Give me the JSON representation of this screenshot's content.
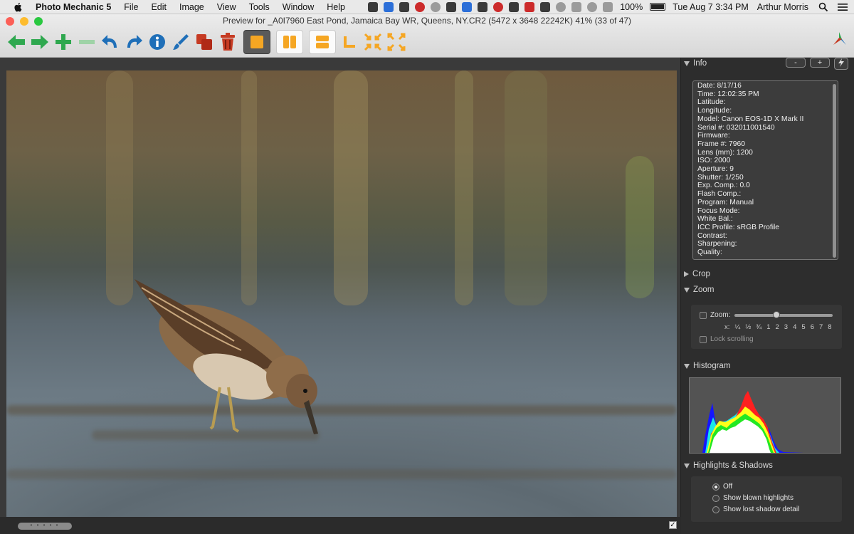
{
  "menubar": {
    "items": [
      "Photo Mechanic 5",
      "File",
      "Edit",
      "Image",
      "View",
      "Tools",
      "Window",
      "Help"
    ],
    "status": {
      "battery": "100%",
      "datetime": "Tue Aug 7  3:34 PM",
      "user": "Arthur Morris"
    }
  },
  "window": {
    "title": "Preview for _A0I7960 East Pond, Jamaica Bay WR, Queens, NY.CR2 (5472 x 3648 22242K) 41% (33 of 47)"
  },
  "toolbar": {
    "icons": [
      "prev-arrow",
      "next-arrow",
      "zoom-in",
      "zoom-out",
      "rotate-left",
      "rotate-right",
      "info",
      "edit-brush",
      "copy",
      "trash",
      "single-view",
      "split-vertical",
      "split-horizontal",
      "crop-corner",
      "fit-arrows",
      "expand-arrows"
    ]
  },
  "panel": {
    "info": {
      "title": "Info",
      "btn_minus": "-",
      "btn_plus": "+",
      "lines": [
        "Date: 8/17/16",
        "Time: 12:02:35 PM",
        "Latitude:",
        "Longitude:",
        "Model: Canon EOS-1D X Mark II",
        "Serial #: 032011001540",
        "Firmware:",
        "Frame #: 7960",
        "Lens (mm): 1200",
        "ISO: 2000",
        "Aperture: 9",
        "Shutter: 1/250",
        "Exp. Comp.: 0.0",
        "Flash Comp.:",
        "Program: Manual",
        "Focus Mode:",
        "White Bal.:",
        "ICC Profile: sRGB Profile",
        "Contrast:",
        "Sharpening:",
        "Quality:"
      ]
    },
    "crop": {
      "title": "Crop"
    },
    "zoom": {
      "title": "Zoom",
      "label": "Zoom:",
      "scale": [
        "x:",
        "¼",
        "½",
        "¾",
        "1",
        "2",
        "3",
        "4",
        "5",
        "6",
        "7",
        "8"
      ],
      "slider_value": 0.42,
      "lock_label": "Lock scrolling"
    },
    "histogram": {
      "title": "Histogram"
    },
    "highlights": {
      "title": "Highlights & Shadows",
      "options": [
        "Off",
        "Show blown highlights",
        "Show lost shadow detail"
      ],
      "selected": "Off"
    }
  },
  "colors": {
    "accent_orange": "#f5a623",
    "green": "#2fa84f",
    "blue": "#1f6fb8",
    "red": "#c63b23"
  }
}
